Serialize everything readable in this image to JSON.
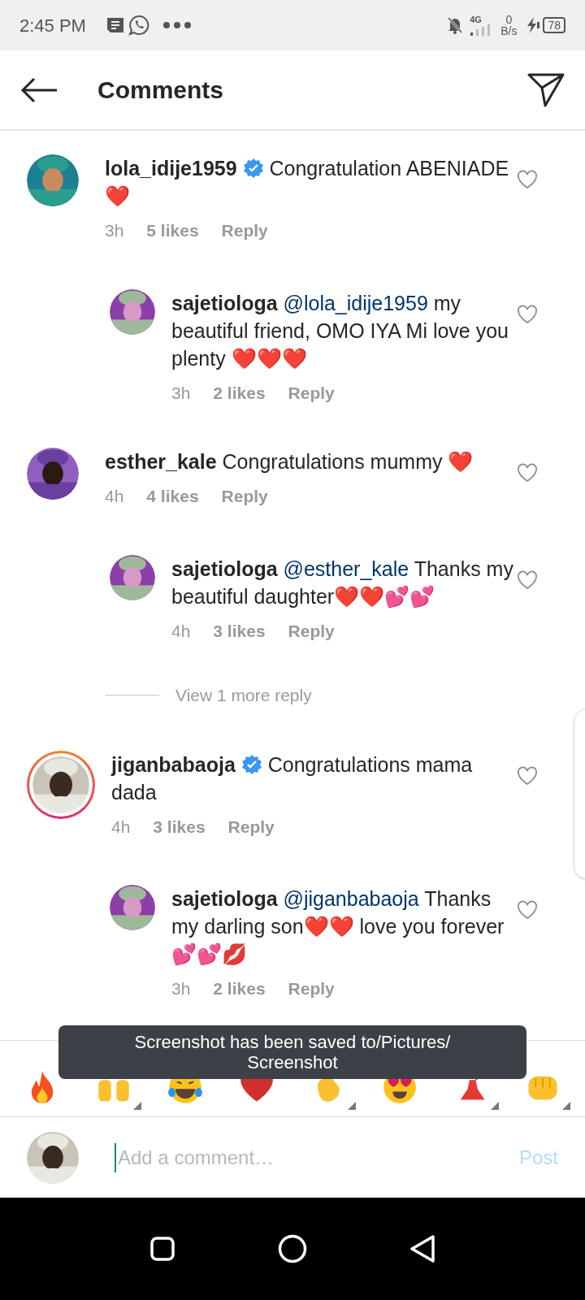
{
  "status_bar": {
    "time": "2:45 PM",
    "network": "4G",
    "speed": "0",
    "speed_unit": "B/s",
    "battery": "78"
  },
  "header": {
    "title": "Comments"
  },
  "comments": [
    {
      "username": "lola_idije1959",
      "verified": true,
      "story_ring": false,
      "text": "Congratulation ABENIADE ❤️",
      "time": "3h",
      "likes": "5 likes",
      "reply_label": "Reply",
      "replies": [
        {
          "username": "sajetiologa",
          "mention": "@lola_idije1959",
          "text": "my beautiful friend, OMO IYA Mi love you plenty ❤️❤️❤️",
          "time": "3h",
          "likes": "2 likes",
          "reply_label": "Reply"
        }
      ]
    },
    {
      "username": "esther_kale",
      "verified": false,
      "story_ring": false,
      "text": "Congratulations mummy ❤️",
      "time": "4h",
      "likes": "4 likes",
      "reply_label": "Reply",
      "replies": [
        {
          "username": "sajetiologa",
          "mention": "@esther_kale",
          "text": "Thanks my beautiful daughter❤️❤️💕💕",
          "time": "4h",
          "likes": "3 likes",
          "reply_label": "Reply"
        }
      ],
      "view_more": "View 1 more reply"
    },
    {
      "username": "jiganbabaoja",
      "verified": true,
      "story_ring": true,
      "text": "Congratulations mama dada",
      "time": "4h",
      "likes": "3 likes",
      "reply_label": "Reply",
      "replies": [
        {
          "username": "sajetiologa",
          "mention": "@jiganbabaoja",
          "text": "Thanks my darling son❤️❤️ love you forever💕💕💋",
          "time": "3h",
          "likes": "2 likes",
          "reply_label": "Reply"
        }
      ]
    }
  ],
  "toast": "Screenshot has been saved to/Pictures/Screenshot",
  "composer": {
    "placeholder": "Add a comment…",
    "post": "Post",
    "post_disabled": true
  }
}
